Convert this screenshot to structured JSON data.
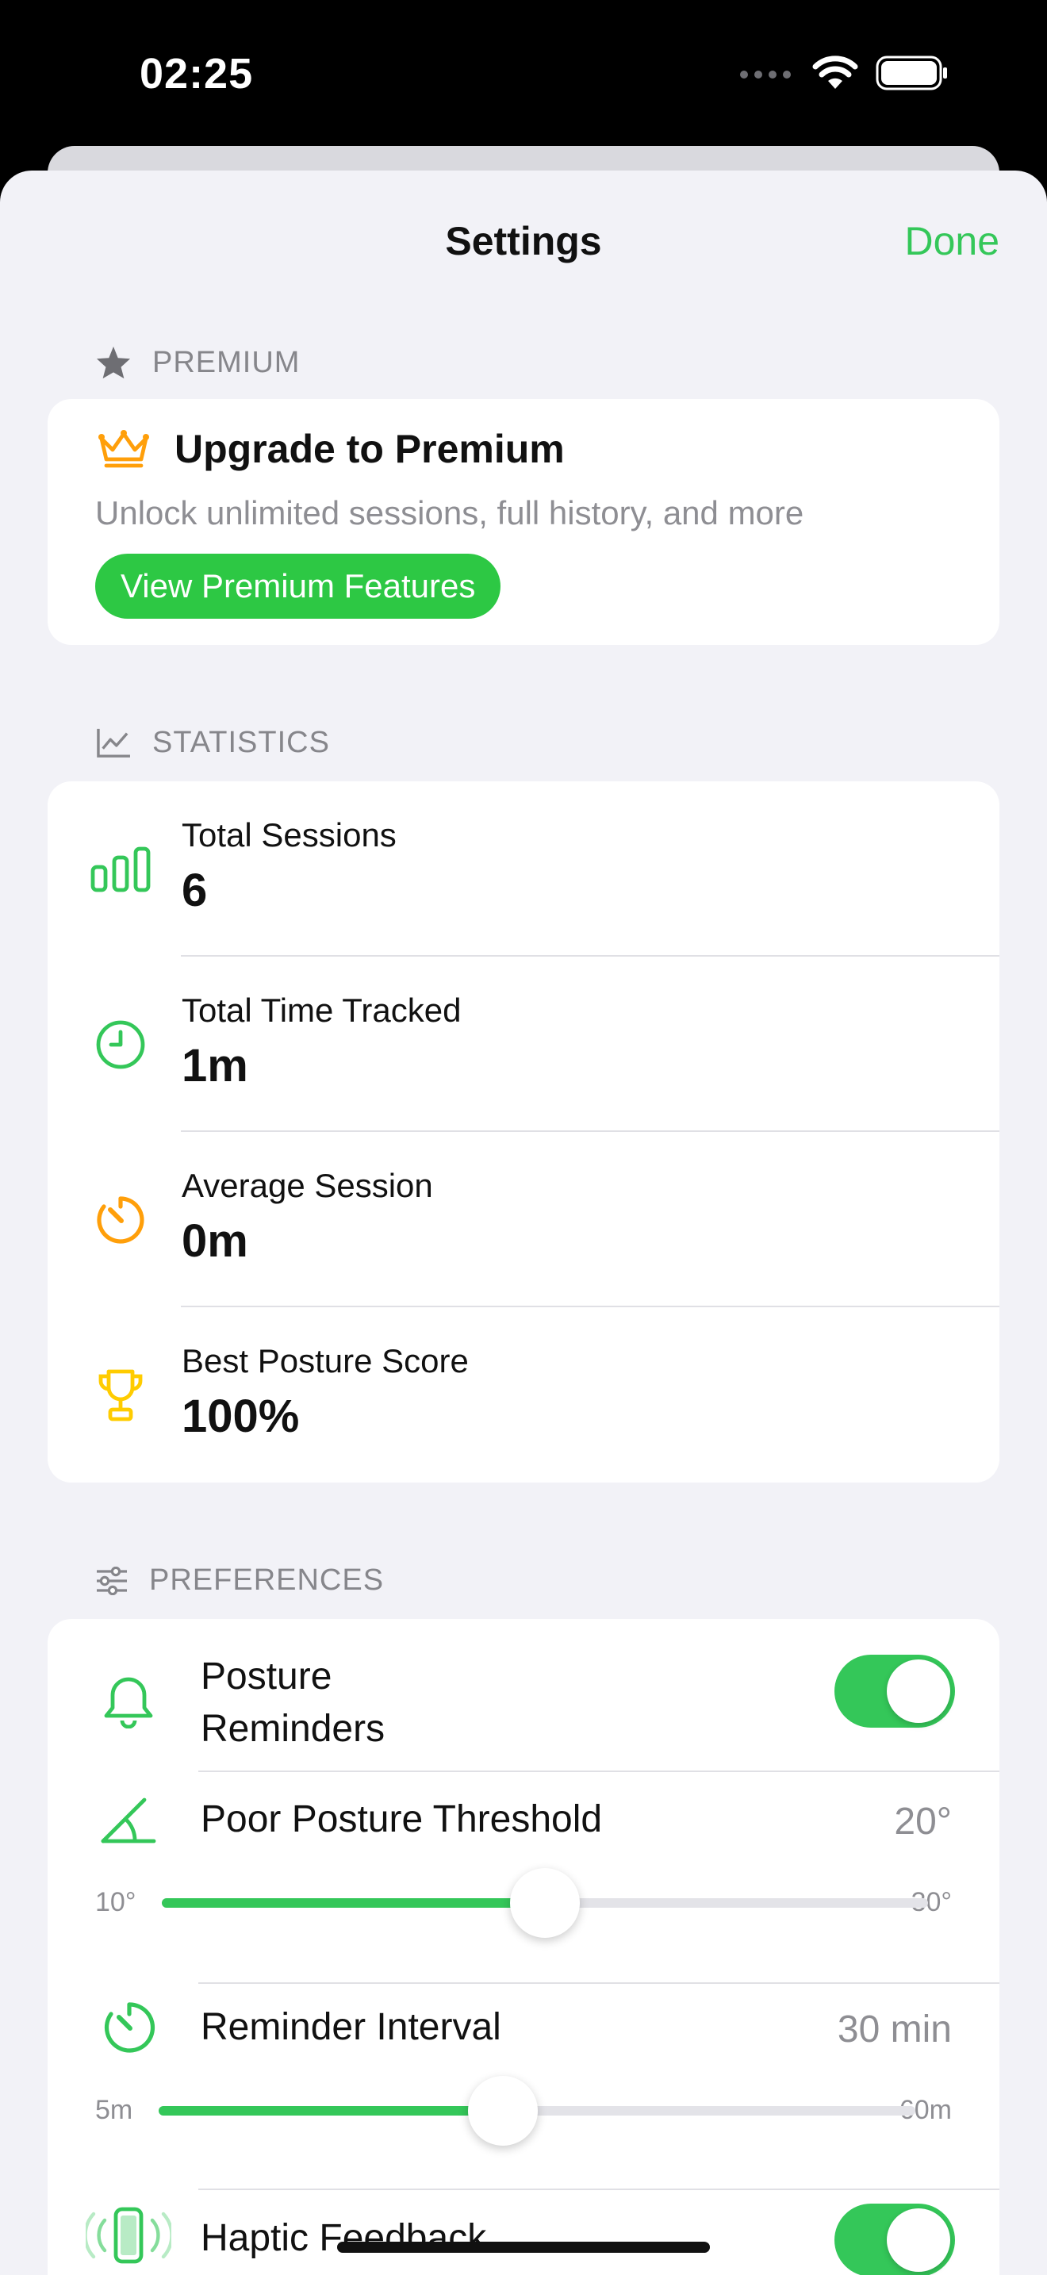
{
  "status_bar": {
    "time": "02:25"
  },
  "nav": {
    "title": "Settings",
    "done_label": "Done"
  },
  "premium": {
    "section_label": "PREMIUM",
    "title": "Upgrade to Premium",
    "description": "Unlock unlimited sessions, full history, and more",
    "button_label": "View Premium Features"
  },
  "statistics": {
    "section_label": "STATISTICS",
    "items": [
      {
        "label": "Total Sessions",
        "value": "6",
        "icon": "bar-chart-icon"
      },
      {
        "label": "Total Time Tracked",
        "value": "1m",
        "icon": "clock-icon"
      },
      {
        "label": "Average Session",
        "value": "0m",
        "icon": "timer-icon"
      },
      {
        "label": "Best Posture Score",
        "value": "100%",
        "icon": "trophy-icon"
      }
    ]
  },
  "preferences": {
    "section_label": "PREFERENCES",
    "posture_reminders": {
      "label": "Posture Reminders",
      "enabled": true
    },
    "threshold": {
      "label": "Poor Posture Threshold",
      "value_text": "20°",
      "min_label": "10°",
      "max_label": "30°",
      "value": 20,
      "min": 10,
      "max": 30
    },
    "interval": {
      "label": "Reminder Interval",
      "value_text": "30 min",
      "min_label": "5m",
      "max_label": "60m",
      "value": 30,
      "min": 5,
      "max": 60
    },
    "haptic": {
      "label": "Haptic Feedback",
      "enabled": true
    }
  },
  "colors": {
    "accent": "#34c759",
    "orange": "#ff9f0a",
    "gold": "#ffcc00",
    "secondary_text": "#8e8e93",
    "background": "#f2f2f7"
  }
}
